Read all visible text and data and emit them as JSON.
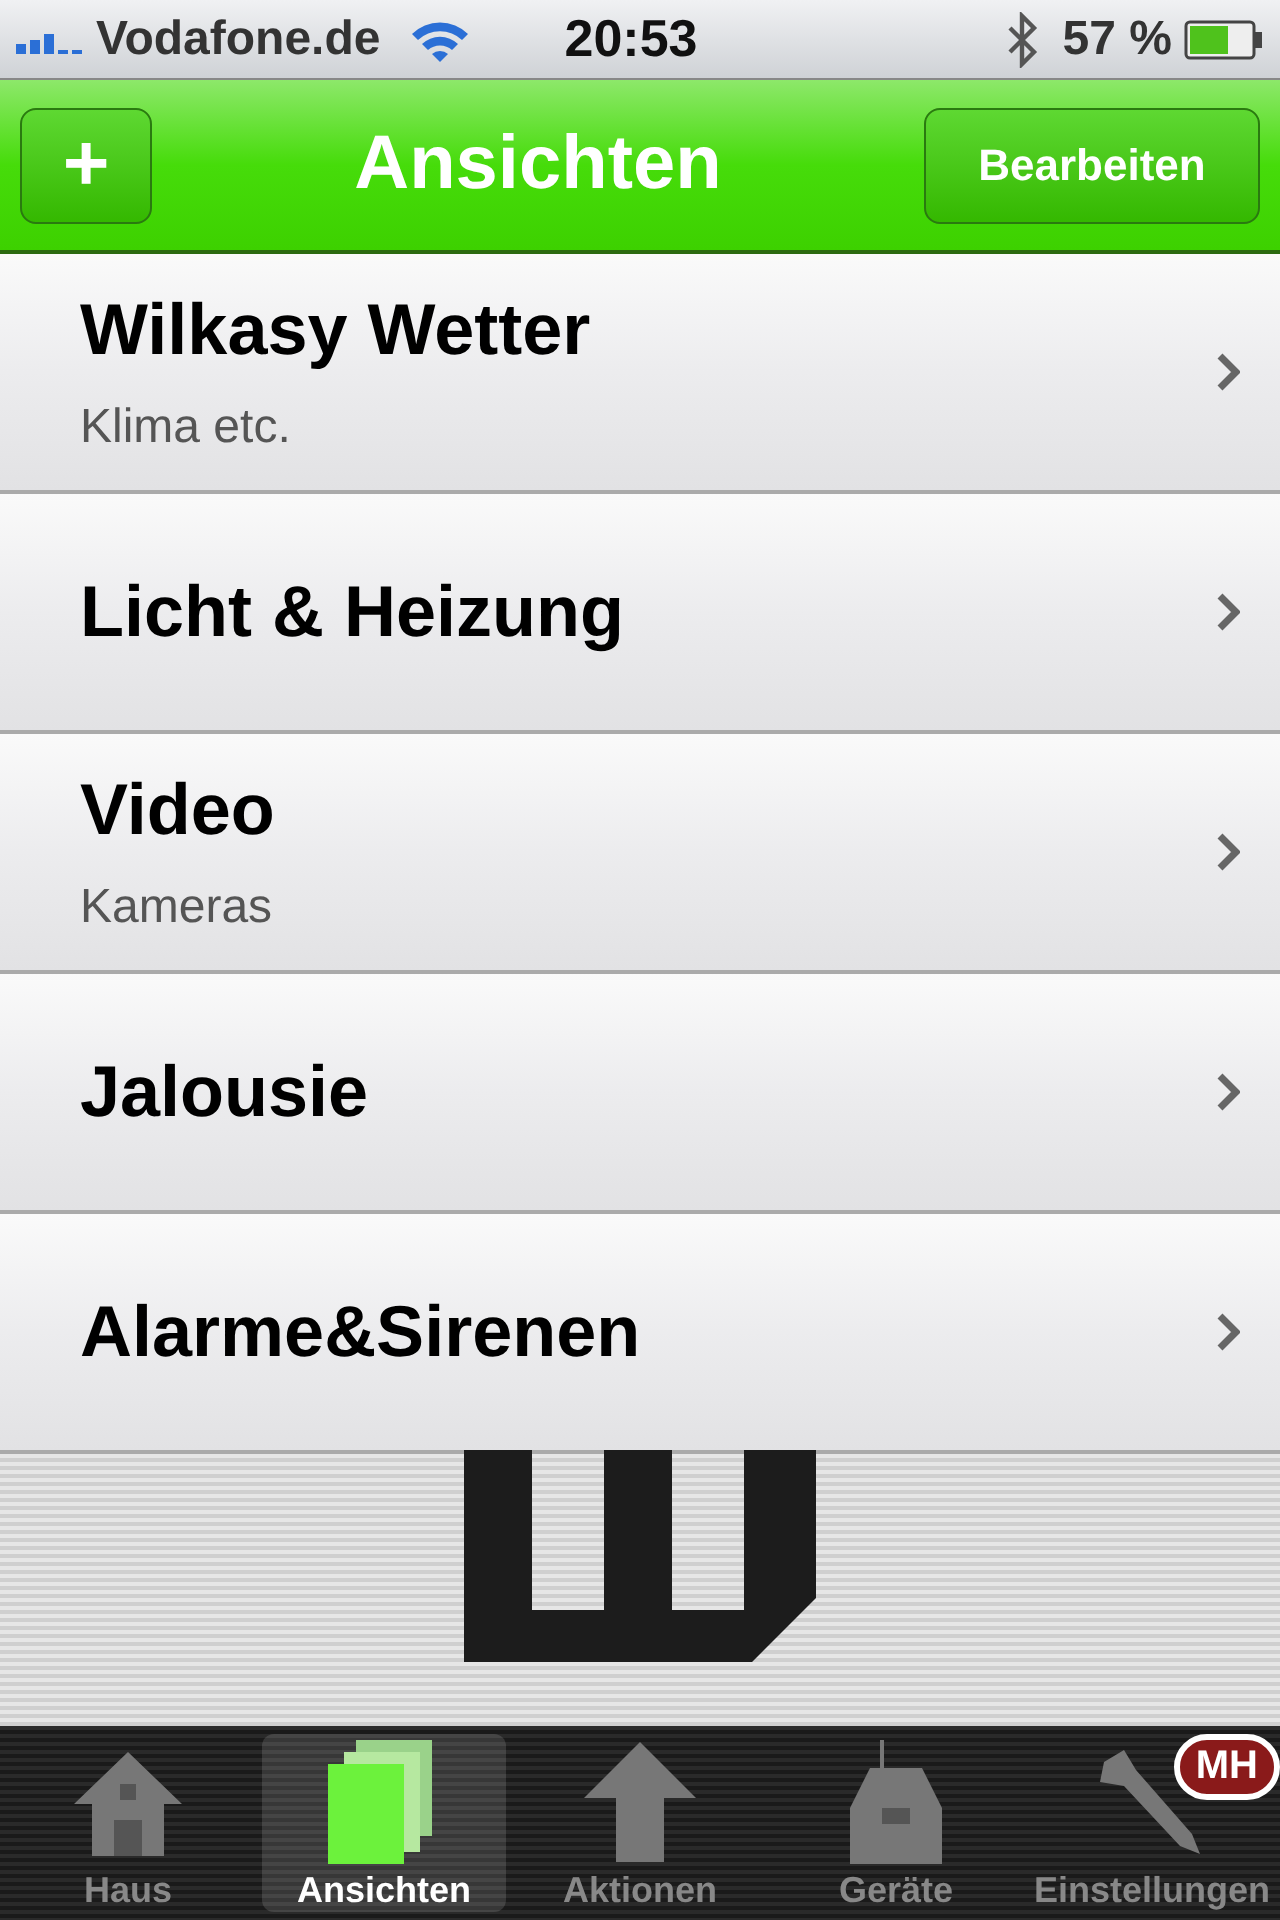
{
  "status_bar": {
    "carrier": "Vodafone.de",
    "time": "20:53",
    "battery": "57 %"
  },
  "nav": {
    "add": "+",
    "title": "Ansichten",
    "edit": "Bearbeiten"
  },
  "rows": [
    {
      "title": "Wilkasy Wetter",
      "subtitle": "Klima etc."
    },
    {
      "title": "Licht & Heizung"
    },
    {
      "title": "Video",
      "subtitle": "Kameras"
    },
    {
      "title": "Jalousie"
    },
    {
      "title": "Alarme&Sirenen"
    }
  ],
  "tabs": [
    {
      "kind": "house",
      "label": "Haus",
      "selected": false
    },
    {
      "kind": "pages",
      "label": "Ansichten",
      "selected": true
    },
    {
      "kind": "arrow",
      "label": "Aktionen",
      "selected": false
    },
    {
      "kind": "device",
      "label": "Geräte",
      "selected": false
    },
    {
      "kind": "wrench",
      "label": "Einstellungen",
      "selected": false,
      "badge": "MH"
    }
  ]
}
